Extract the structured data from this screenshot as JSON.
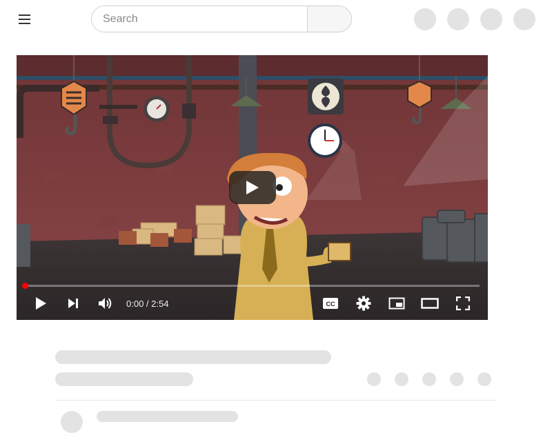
{
  "header": {
    "search": {
      "placeholder": "Search",
      "value": ""
    },
    "avatar_count": 4
  },
  "player": {
    "time_current": "0:00",
    "time_total": "2:54",
    "progress_fraction": 0.0,
    "accent_color": "#ff0000"
  },
  "icons": [
    "menu-icon",
    "search-icon",
    "play-icon",
    "next-icon",
    "volume-icon",
    "captions-icon",
    "settings-icon",
    "miniplayer-icon",
    "theater-icon",
    "fullscreen-icon"
  ]
}
